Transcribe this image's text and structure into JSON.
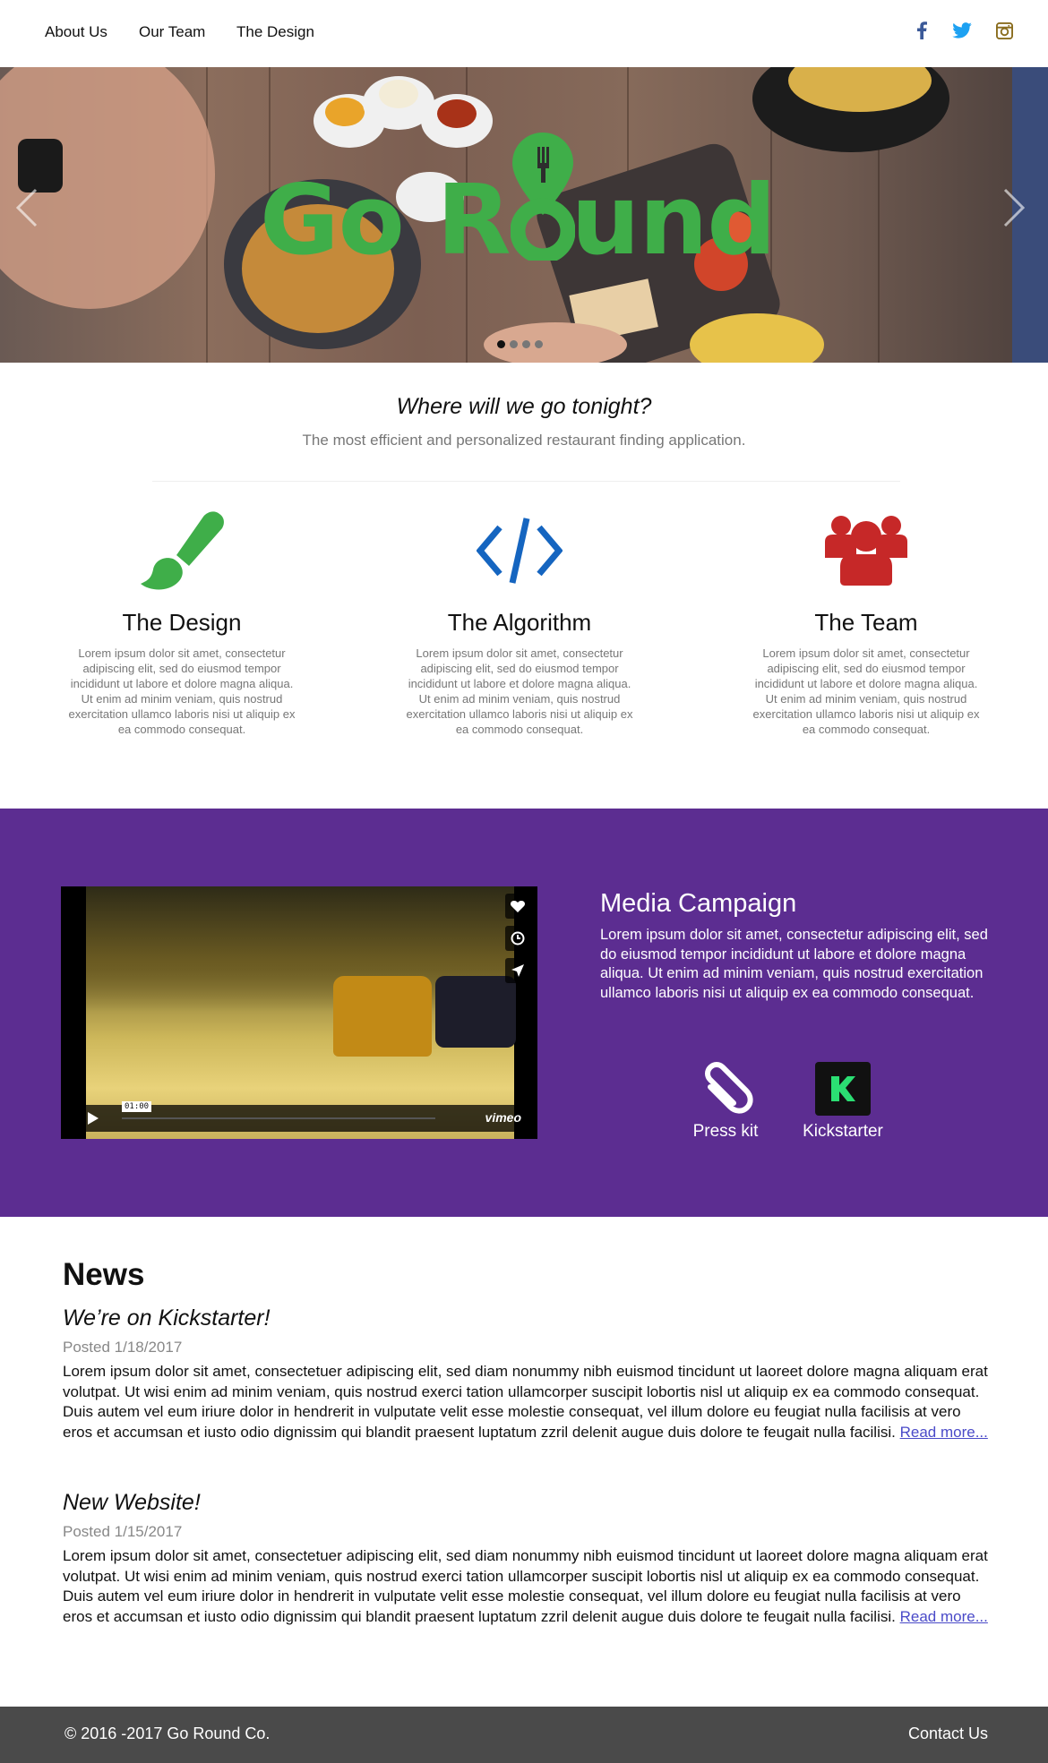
{
  "nav": {
    "items": [
      {
        "label": "About Us"
      },
      {
        "label": "Our Team"
      },
      {
        "label": "The Design"
      }
    ],
    "social": [
      "facebook-icon",
      "twitter-icon",
      "instagram-icon"
    ]
  },
  "hero": {
    "title_part1": "Go R",
    "title_part2": "und",
    "slide_count": 4,
    "active_slide": 1,
    "logo_color": "#3fae49"
  },
  "intro": {
    "tagline": "Where will we go tonight?",
    "subline": "The most efficient and personalized restaurant finding application."
  },
  "features": [
    {
      "icon": "paintbrush-icon",
      "color": "#3fae49",
      "title": "The Design",
      "text": "Lorem ipsum dolor sit amet, consectetur adipiscing elit, sed do eiusmod tempor incididunt ut labore et dolore magna aliqua. Ut enim ad minim veniam, quis nostrud exercitation ullamco laboris nisi ut aliquip ex ea commodo consequat."
    },
    {
      "icon": "code-icon",
      "color": "#1565c0",
      "title": "The Algorithm",
      "text": "Lorem ipsum dolor sit amet, consectetur adipiscing elit, sed do eiusmod tempor incididunt ut labore et dolore magna aliqua. Ut enim ad minim veniam, quis nostrud exercitation ullamco laboris nisi ut aliquip ex ea commodo consequat."
    },
    {
      "icon": "users-icon",
      "color": "#c62828",
      "title": "The Team",
      "text": "Lorem ipsum dolor sit amet, consectetur adipiscing elit, sed do eiusmod tempor incididunt ut labore et dolore magna aliqua. Ut enim ad minim veniam, quis nostrud exercitation ullamco laboris nisi ut aliquip ex ea commodo consequat."
    }
  ],
  "media": {
    "background": "#5c2d91",
    "title": "Media Campaign",
    "text": "Lorem ipsum dolor sit amet, consectetur adipiscing elit, sed do eiusmod tempor incididunt ut labore et dolore magna aliqua. Ut enim ad minim veniam, quis nostrud exercitation ullamco laboris nisi ut aliquip ex ea commodo consequat.",
    "video": {
      "time": "01:00",
      "brand": "vimeo"
    },
    "buttons": [
      {
        "label": "Press kit",
        "icon": "paperclip-icon"
      },
      {
        "label": "Kickstarter",
        "icon": "kickstarter-icon"
      }
    ]
  },
  "news": {
    "title": "News",
    "posts": [
      {
        "title": "We’re on Kickstarter!",
        "date": "Posted 1/18/2017",
        "body": "Lorem ipsum dolor sit amet, consectetuer adipiscing elit, sed diam nonummy nibh euismod tincidunt ut laoreet dolore magna aliquam erat volutpat. Ut wisi enim ad minim veniam, quis nostrud exerci tation ullamcorper suscipit lobortis nisl ut aliquip ex ea commodo consequat. Duis autem vel eum iriure dolor in hendrerit in vulputate velit esse molestie consequat, vel illum dolore eu feugiat nulla facilisis at vero eros et accumsan et iusto odio dignissim qui blandit praesent luptatum zzril delenit augue duis dolore te feugait nulla facilisi.",
        "more": "Read more..."
      },
      {
        "title": "New Website!",
        "date": "Posted 1/15/2017",
        "body": "Lorem ipsum dolor sit amet, consectetuer adipiscing elit, sed diam nonummy nibh euismod tincidunt ut laoreet dolore magna aliquam erat volutpat. Ut wisi enim ad minim veniam, quis nostrud exerci tation ullamcorper suscipit lobortis nisl ut aliquip ex ea commodo consequat. Duis autem vel eum iriure dolor in hendrerit in vulputate velit esse molestie consequat, vel illum dolore eu feugiat nulla facilisis at vero eros et accumsan et iusto odio dignissim qui blandit praesent luptatum zzril delenit augue duis dolore te feugait nulla facilisi.",
        "more": "Read more..."
      }
    ]
  },
  "footer": {
    "copyright": "© 2016 -2017 Go Round Co.",
    "contact": "Contact Us"
  }
}
